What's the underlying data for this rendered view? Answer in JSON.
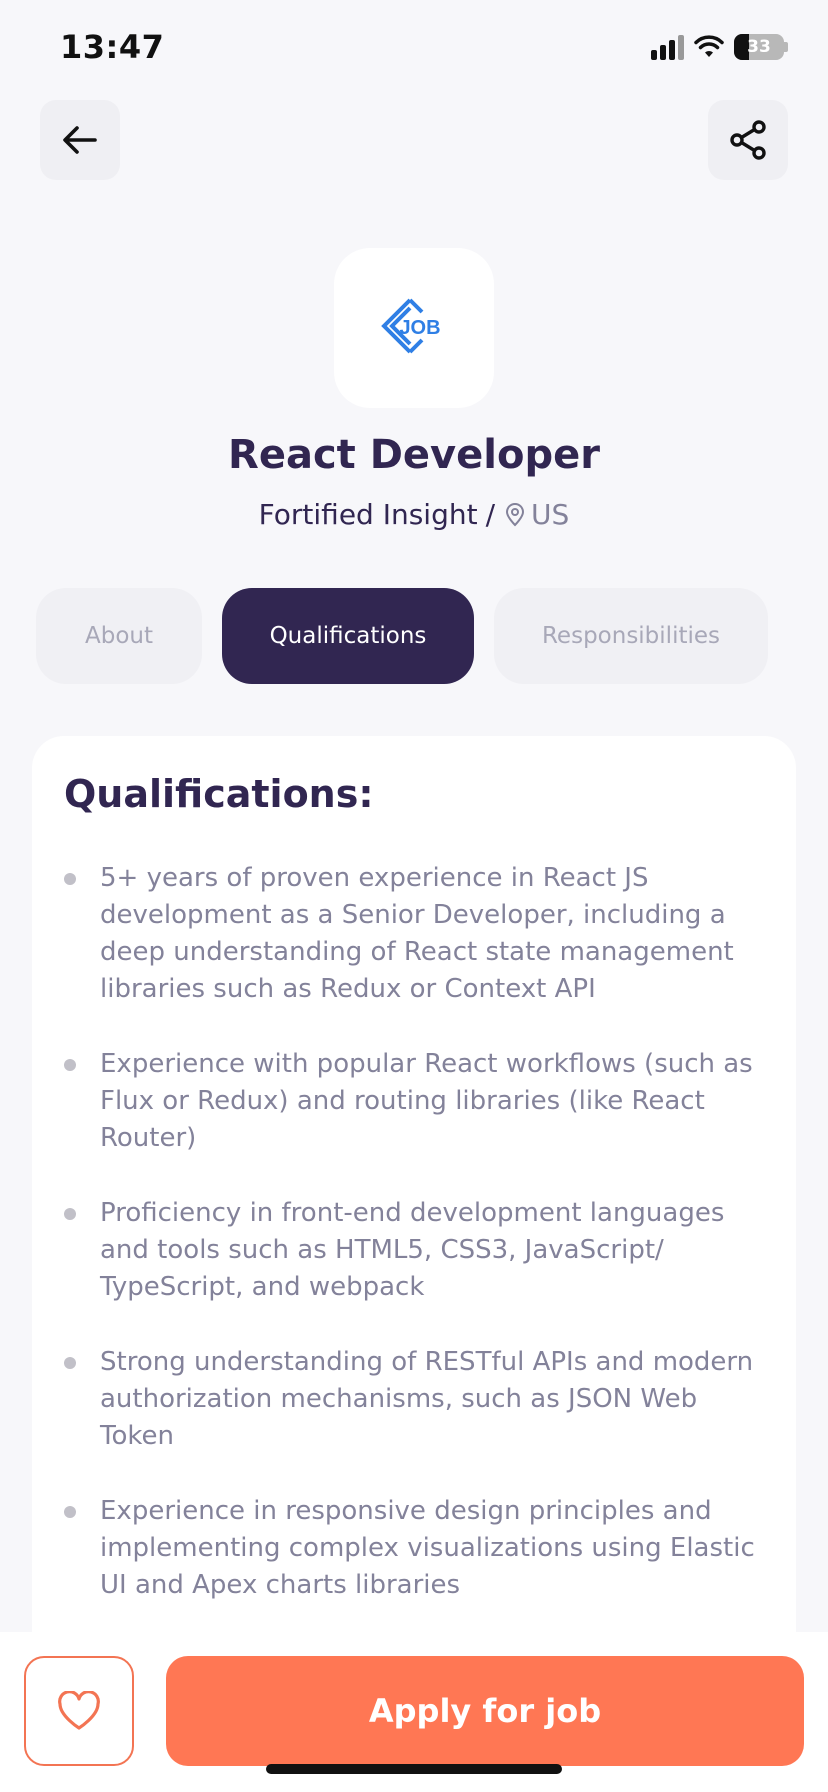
{
  "status_bar": {
    "time": "13:47",
    "battery": "33"
  },
  "header": {
    "back_icon": "arrow-left-icon",
    "share_icon": "share-icon"
  },
  "company": {
    "logo_text": "JOB",
    "logo_color": "#2F7FE5"
  },
  "job": {
    "title": "React Developer",
    "company_name": "Fortified Insight",
    "separator": "/",
    "location": "US"
  },
  "tabs": [
    {
      "label": "About",
      "active": false
    },
    {
      "label": "Qualifications",
      "active": true
    },
    {
      "label": "Responsibilities",
      "active": false
    }
  ],
  "section": {
    "title": "Qualifications:",
    "items": [
      "5+ years of proven experience in React JS development as a Senior Developer, including a deep understanding of React state management libraries such as Redux or Context API",
      "Experience with popular React workflows (such as Flux or Redux) and routing libraries (like React Router)",
      "Proficiency in front-end development languages and tools such as HTML5, CSS3, JavaScript/ TypeScript, and webpack",
      "Strong understanding of RESTful APIs and modern authorization mechanisms, such as JSON Web Token",
      "Experience in responsive design principles and implementing complex visualizations using Elastic UI and Apex charts libraries"
    ]
  },
  "footer": {
    "apply_label": "Apply for job",
    "like_icon": "heart-icon"
  },
  "colors": {
    "primary": "#312651",
    "accent": "#FF7754",
    "gray": "#83829A",
    "background": "#F7F7FA"
  }
}
